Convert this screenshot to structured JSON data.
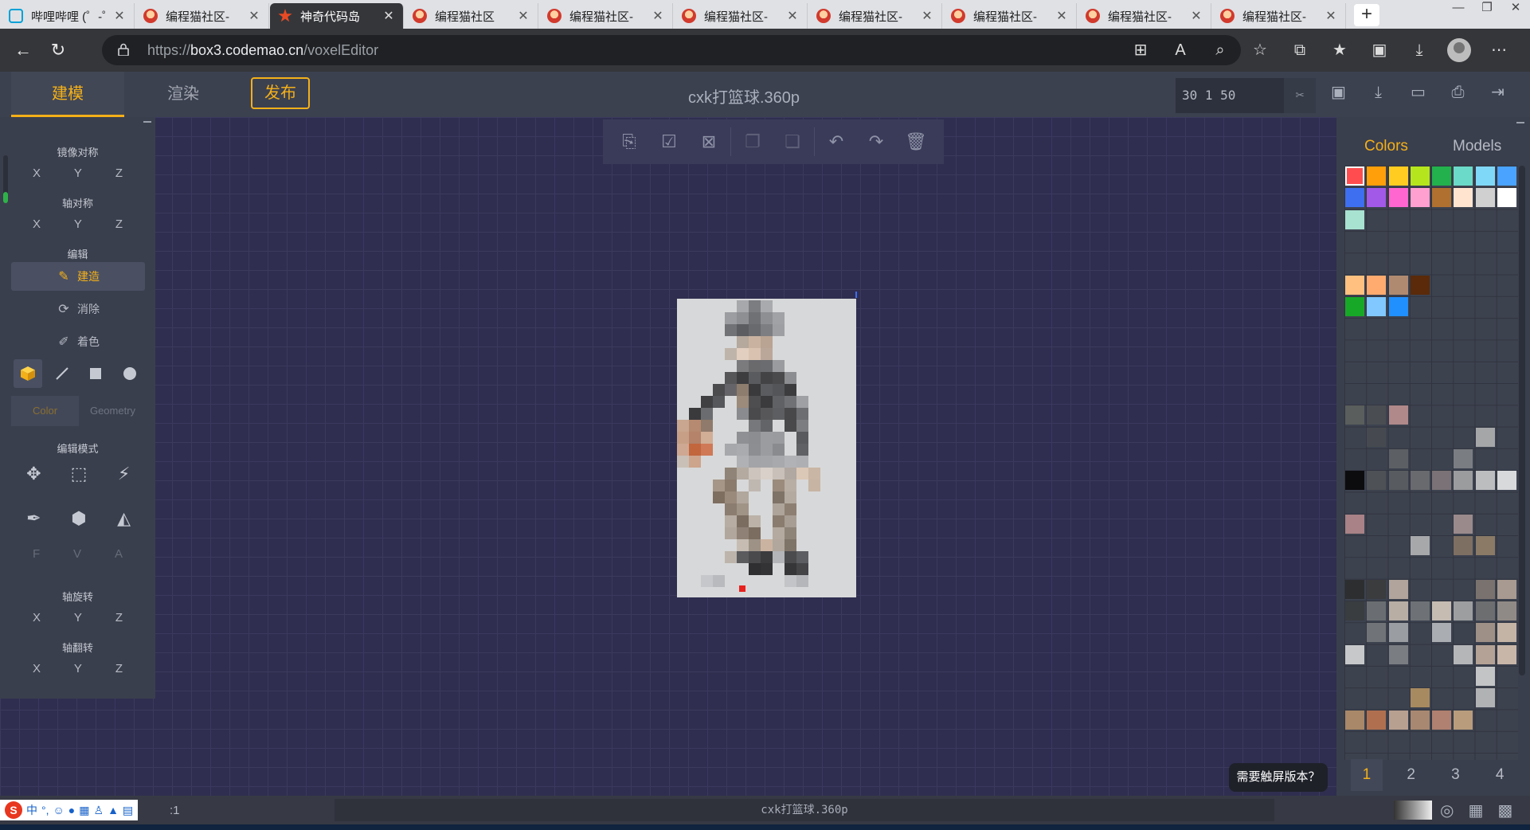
{
  "browser": {
    "tabs": [
      {
        "label": "哔哩哔哩 (゜-゜",
        "icon": "bilibili-icon",
        "active": false
      },
      {
        "label": "编程猫社区-",
        "icon": "codemao-icon",
        "active": false
      },
      {
        "label": "神奇代码岛",
        "icon": "box3-icon",
        "active": true
      },
      {
        "label": "编程猫社区",
        "icon": "codemao-icon",
        "active": false
      },
      {
        "label": "编程猫社区-",
        "icon": "codemao-icon",
        "active": false
      },
      {
        "label": "编程猫社区-",
        "icon": "codemao-icon",
        "active": false
      },
      {
        "label": "编程猫社区-",
        "icon": "codemao-icon",
        "active": false
      },
      {
        "label": "编程猫社区-",
        "icon": "codemao-icon",
        "active": false
      },
      {
        "label": "编程猫社区-",
        "icon": "codemao-icon",
        "active": false
      },
      {
        "label": "编程猫社区-",
        "icon": "codemao-icon",
        "active": false
      }
    ],
    "new_tab": "+",
    "url_prefix": "https://",
    "url_host": "box3.codemao.cn",
    "url_path": "/voxelEditor"
  },
  "app": {
    "tabs": {
      "model": "建模",
      "render": "渲染"
    },
    "publish": "发布",
    "title": "cxk打篮球.360p",
    "coords": "30 1 50"
  },
  "left": {
    "mirror_title": "镜像对称",
    "axis_sym_title": "轴对称",
    "edit_title": "编辑",
    "build": "建造",
    "erase": "消除",
    "paint": "着色",
    "color_tab": "Color",
    "geometry_tab": "Geometry",
    "edit_mode_title": "编辑模式",
    "fva": [
      "F",
      "V",
      "A"
    ],
    "rotate_title": "轴旋转",
    "flip_title": "轴翻转",
    "axes": [
      "X",
      "Y",
      "Z"
    ]
  },
  "right": {
    "colors_tab": "Colors",
    "models_tab": "Models",
    "pages": [
      "1",
      "2",
      "3",
      "4"
    ],
    "active_page": "1",
    "accent": "#f4b019"
  },
  "touch_hint": "需要触屏版本？",
  "status": {
    "zoom": ":1",
    "file": "cxk打篮球.360p"
  },
  "ime": {
    "logo": "S",
    "mode": "中"
  }
}
